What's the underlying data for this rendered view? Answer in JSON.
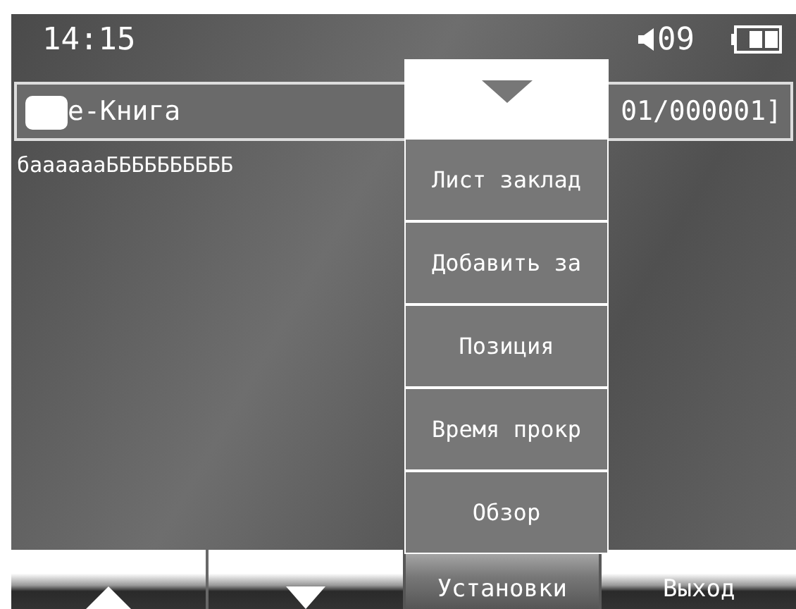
{
  "status_bar": {
    "time": "14:15",
    "volume": "09"
  },
  "title_bar": {
    "title": "e-Книга",
    "page": "01/000001]"
  },
  "content": {
    "text": "бааааааББББББББББ"
  },
  "menu": {
    "items": [
      {
        "label": "Лист заклад"
      },
      {
        "label": "Добавить за"
      },
      {
        "label": "Позиция"
      },
      {
        "label": "Время прокр"
      },
      {
        "label": "Обзор"
      }
    ]
  },
  "soft_keys": [
    {
      "kind": "up",
      "selected": false
    },
    {
      "kind": "down",
      "selected": false
    },
    {
      "kind": "text",
      "label": "Установки",
      "selected": true
    },
    {
      "kind": "text",
      "label": "Выход",
      "selected": false
    }
  ]
}
